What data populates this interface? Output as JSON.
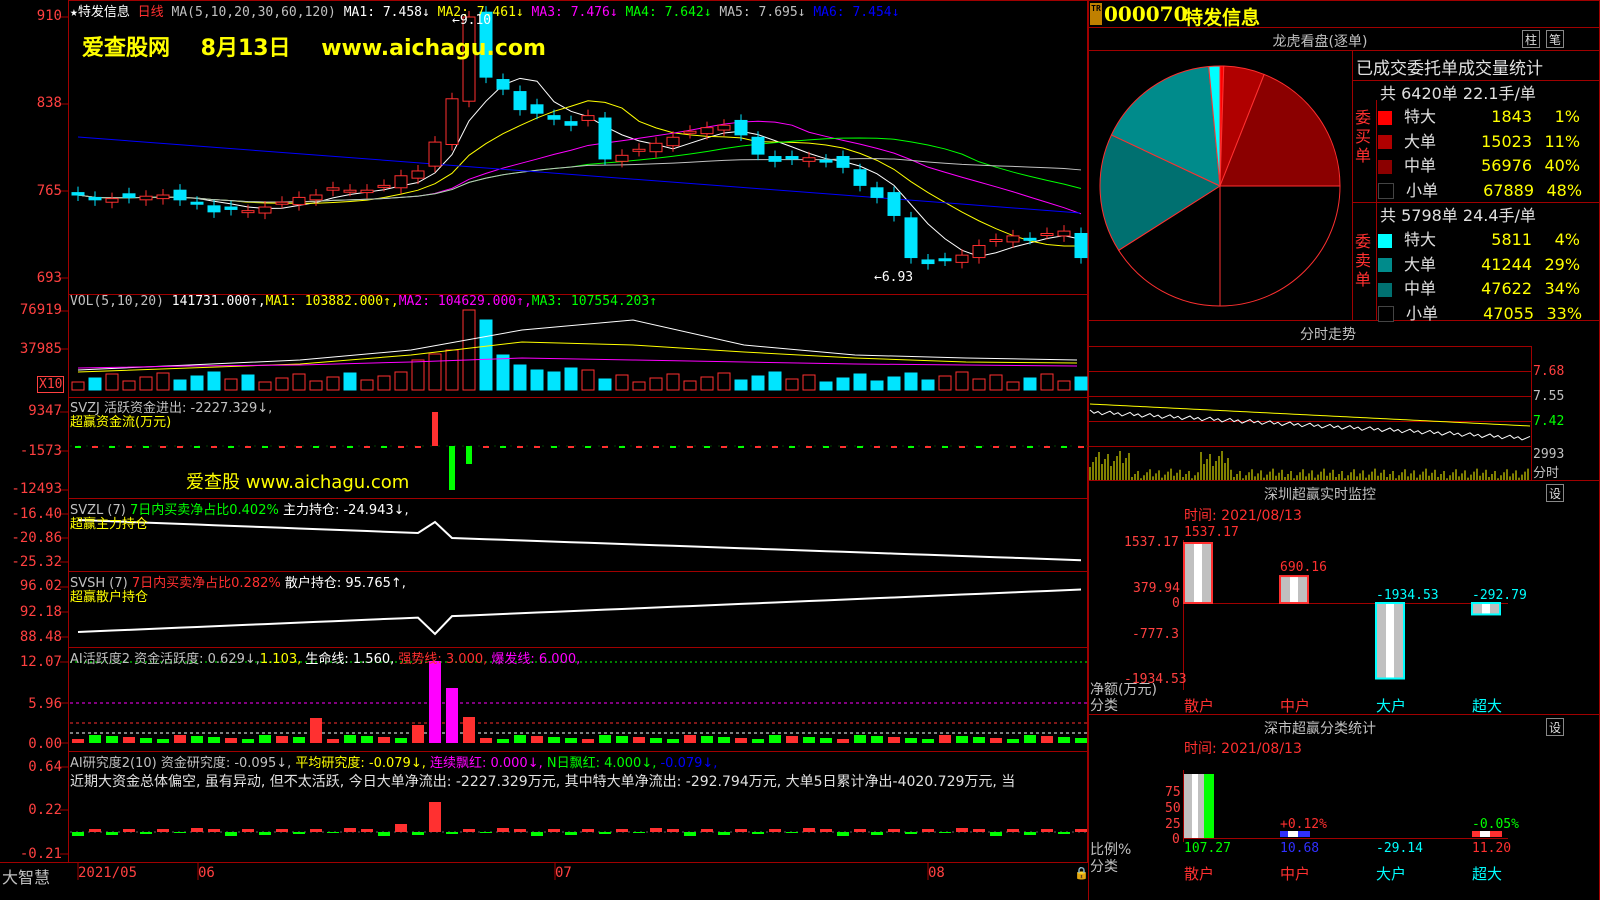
{
  "colors": {
    "up": "#ff3030",
    "down": "#00e5ff",
    "ma1": "#ffffff",
    "ma2": "#ffff00",
    "ma3": "#ff00ff",
    "ma4": "#00ff00",
    "ma5": "#c0c0c0",
    "ma6": "#0000ff",
    "grid": "#a00000"
  },
  "main": {
    "star": "★",
    "stock_name": "特发信息",
    "period": "日线",
    "ma_params": "MA(5,10,20,30,60,120)",
    "ma": [
      {
        "label": "MA1: 7.458↓",
        "color": "#ffffff"
      },
      {
        "label": "MA2: 7.461↓",
        "color": "#ffff00"
      },
      {
        "label": "MA3: 7.476↓",
        "color": "#ff00ff"
      },
      {
        "label": "MA4: 7.642↓",
        "color": "#00ff00"
      },
      {
        "label": "MA5: 7.695↓",
        "color": "#c0c0c0"
      },
      {
        "label": "MA6: 7.454↓",
        "color": "#0000ff"
      }
    ],
    "watermark": "爱查股网    8月13日    www.aichagu.com",
    "high_label": "9.10",
    "low_label": "6.93",
    "yticks": [
      "910",
      "838",
      "765",
      "693"
    ]
  },
  "vol": {
    "legend": [
      {
        "text": "VOL(5,10,20)",
        "color": "#c0c0c0"
      },
      {
        "text": " 141731.000↑,",
        "color": "#ffffff"
      },
      {
        "text": "MA1: 103882.000↑,",
        "color": "#ffff00"
      },
      {
        "text": "MA2: 104629.000↑,",
        "color": "#ff00ff"
      },
      {
        "text": "MA3: 107554.203↑",
        "color": "#00ff00"
      }
    ],
    "yticks": [
      "76919",
      "37985"
    ],
    "unit": "X10"
  },
  "svzj": {
    "legend_line1": "SVZJ  活跃资金进出: -2227.329↓,",
    "legend_line2": "超赢资金流(万元)",
    "watermark": "爱查股 www.aichagu.com",
    "yticks": [
      "9347",
      "-1573",
      "-12493"
    ]
  },
  "svzl": {
    "legend_a": "SVZL (7)",
    "legend_b": "7日内买卖净占比0.402%",
    "legend_c": "主力持仓: -24.943↓,",
    "legend_line2": "超赢主力持仓",
    "yticks": [
      "-16.40",
      "-20.86",
      "-25.32"
    ]
  },
  "svsh": {
    "legend_a": "SVSH (7)",
    "legend_b": "7日内买卖净占比0.282%",
    "legend_c": "散户持仓: 95.765↑,",
    "legend_line2": "超赢散户持仓",
    "yticks": [
      "96.02",
      "92.18",
      "88.48"
    ]
  },
  "ai1": {
    "legend": [
      {
        "text": "AI活跃度2 资金活跃度: 0.629↓,",
        "color": "#c0c0c0"
      },
      {
        "text": "1.103,",
        "color": "#ffff00"
      },
      {
        "text": " 生命线: 1.560,",
        "color": "#ffffff"
      },
      {
        "text": " 强势线: 3.000,",
        "color": "#ff3030"
      },
      {
        "text": " 爆发线: 6.000,",
        "color": "#ff00ff"
      }
    ],
    "yticks": [
      "12.07",
      "5.96",
      "0.00"
    ]
  },
  "ai2": {
    "legend": [
      {
        "text": "AI研究度2(10) 资金研究度: -0.095↓,",
        "color": "#c0c0c0"
      },
      {
        "text": " 平均研究度: -0.079↓,",
        "color": "#ffff00"
      },
      {
        "text": " 连续飘红: 0.000↓,",
        "color": "#ff00ff"
      },
      {
        "text": " N日飘红: 4.000↓,",
        "color": "#00ff00"
      },
      {
        "text": " -0.079↓,",
        "color": "#0000ff"
      }
    ],
    "text": "近期大资金总体偏空, 虽有异动, 但不太活跃, 今日大单净流出: -2227.329万元, 其中特大单净流出: -292.794万元, 大单5日累计净出-4020.729万元, 当",
    "yticks": [
      "0.64",
      "0.22",
      "-0.21"
    ]
  },
  "xaxis": {
    "brand": "大智慧",
    "labels": [
      "2021/05",
      "06",
      "07",
      "08"
    ]
  },
  "right": {
    "code": "000070",
    "name": "特发信息",
    "tr_icon": "TR",
    "lhb_title": "龙虎看盘(逐单)",
    "btn_zhu": "柱",
    "btn_bi": "笔",
    "stats_title": "已成交委托单成交量统计",
    "buy": {
      "header": "共 6420单 22.1手/单",
      "side_label": "委买单",
      "rows": [
        {
          "name": "特大",
          "vol": "1843",
          "pct": "1%",
          "color": "#ff0000"
        },
        {
          "name": "大单",
          "vol": "15023",
          "pct": "11%",
          "color": "#b00000"
        },
        {
          "name": "中单",
          "vol": "56976",
          "pct": "40%",
          "color": "#8b0000"
        },
        {
          "name": "小单",
          "vol": "67889",
          "pct": "48%",
          "color": "#000000"
        }
      ]
    },
    "sell": {
      "header": "共 5798单 24.4手/单",
      "side_label": "委卖单",
      "rows": [
        {
          "name": "特大",
          "vol": "5811",
          "pct": "4%",
          "color": "#00ffff"
        },
        {
          "name": "大单",
          "vol": "41244",
          "pct": "29%",
          "color": "#008b8b"
        },
        {
          "name": "中单",
          "vol": "47622",
          "pct": "34%",
          "color": "#007070"
        },
        {
          "name": "小单",
          "vol": "47055",
          "pct": "33%",
          "color": "#000000"
        }
      ]
    },
    "intraday_title": "分时走势",
    "intraday_yticks": [
      "7.68",
      "7.55",
      "7.42"
    ],
    "intraday_vol": "2993",
    "intraday_vol_unit": "分时",
    "monitor_title": "深圳超赢实时监控",
    "monitor_btn": "设",
    "monitor_time": "时间: 2021/08/13",
    "monitor_yticks": [
      "1537.17",
      "379.94",
      "0",
      "-777.3",
      "-1934.53"
    ],
    "monitor_bars": [
      {
        "label": "1537.17",
        "value": 1537.17,
        "color": "#ff3030"
      },
      {
        "label": "690.16",
        "value": 690.16,
        "color": "#ff3030"
      },
      {
        "label": "-1934.53",
        "value": -1934.53,
        "color": "#00ffff"
      },
      {
        "label": "-292.79",
        "value": -292.79,
        "color": "#00ffff"
      }
    ],
    "monitor_ylabel": "净额(万元)",
    "monitor_xlabel": "分类",
    "categories": [
      {
        "name": "散户",
        "color": "#ff3030"
      },
      {
        "name": "中户",
        "color": "#ff3030"
      },
      {
        "name": "大户",
        "color": "#00ffff"
      },
      {
        "name": "超大",
        "color": "#00ffff"
      }
    ],
    "class_title": "深市超赢分类统计",
    "class_btn": "设",
    "class_time": "时间: 2021/08/13",
    "class_yticks": [
      "75",
      "50",
      "25",
      "0"
    ],
    "class_values": [
      {
        "label": "107.27",
        "color": "#00ff00"
      },
      {
        "label": "10.68",
        "color": "#3030ff"
      },
      {
        "label": "-29.14",
        "color": "#00ffff"
      },
      {
        "label": "11.20",
        "color": "#ff3030"
      }
    ],
    "class_pct": [
      "+0.12%",
      "-0.05%"
    ],
    "class_ylabel": "比例%",
    "class_xlabel": "分类"
  }
}
